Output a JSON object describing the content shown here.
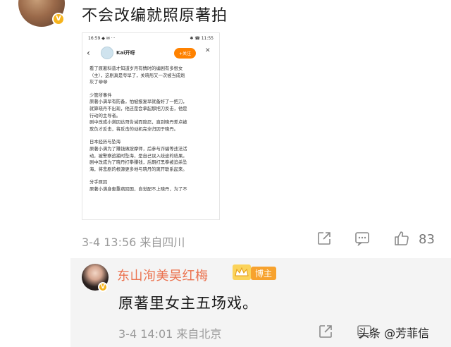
{
  "top_comment": {
    "text": "不会改编就照原著拍",
    "verified_badge": "V"
  },
  "embedded_screenshot": {
    "status_left": "16:59 ◆ ✉ ···",
    "status_right": "✱ ☎ 11:55",
    "account_name": "Kai开呀",
    "follow_label": "+关注",
    "close_icon": "✕",
    "paragraphs": [
      [
        "看了原著科普才知道岁月有情时的编剧有多恨女",
        "（主），这剧真是夸早了，关晓彤又一次被当成炮",
        "灰了😁😁"
      ],
      [
        "少管所事件",
        "原著小满早有防备，怕被报复早就备好了一把刀，",
        "就算晓丹不出现，他还是会拿起那把刀反击，他是",
        "行动的主导者。",
        "剧中改成小满因达哥告诫而隐忍，直到晓丹差点被",
        "欺负才反击，将反击的动机完全归因于晓丹。"
      ],
      [
        "日本经历与坠海",
        "原著小满为了赚钱做按摩师，后参与诈骗等违法活",
        "动，被警察追捕时坠海，是自己误入歧途的结果。",
        "剧中改成为了晓丹打拳赚钱，后期打黑拳被追杀坠",
        "海，将悲剧的根源更多地与晓丹的离开联系起来。"
      ],
      [
        "分手原因",
        "原著小满身患重病回国，自觉配不上晓丹，为了不"
      ]
    ]
  },
  "comment_meta": {
    "time": "3-4 13:56",
    "location": "来自四川",
    "likes": "83"
  },
  "reply": {
    "author": "东山洵美吴红梅",
    "author_tag": "博主",
    "text": "原著里女主五场戏。",
    "time": "3-4 14:01",
    "location": "来自北京"
  },
  "watermark": "头条 @芳菲信"
}
